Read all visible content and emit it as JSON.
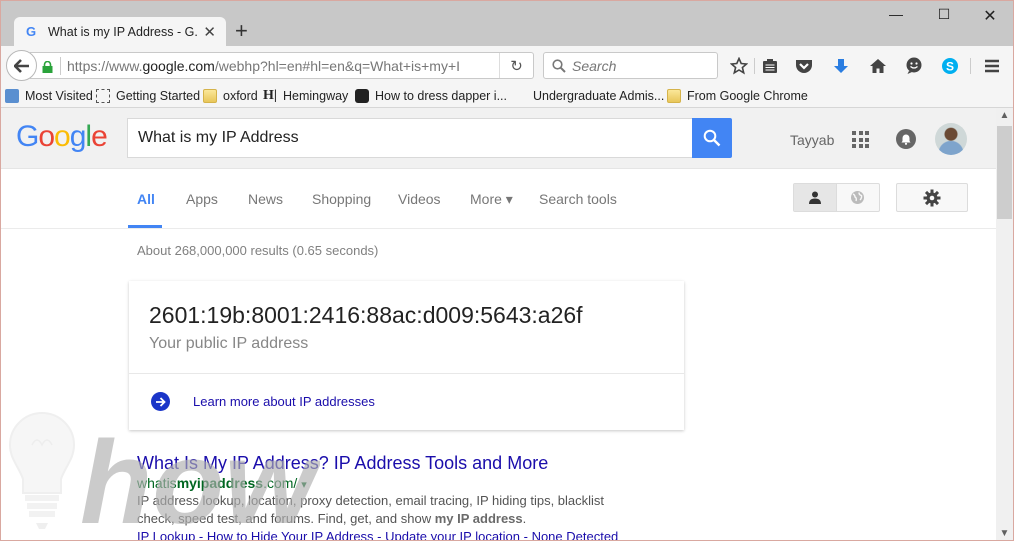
{
  "browser": {
    "tab_title": "What is my IP Address - G...",
    "new_tab_icon": "plus-icon",
    "window_controls": [
      "minimize",
      "maximize",
      "close"
    ],
    "url_host": "https://www.google.com",
    "url_prefix": "https://www.",
    "url_domain": "google.com",
    "url_path": "/webhp?hl=en#hl=en&q=What+is+my+I",
    "search_placeholder": "Search",
    "toolbar_icons": [
      "bookmark-star-icon",
      "reading-list-icon",
      "pocket-icon",
      "download-icon",
      "home-icon",
      "chat-icon",
      "skype-icon",
      "menu-icon"
    ],
    "download_color": "#2a7de1",
    "skype_color": "#00aff0"
  },
  "bookmarks": [
    {
      "label": "Most Visited",
      "icon": "most-visited-icon"
    },
    {
      "label": "Getting Started",
      "icon": "getting-started-icon"
    },
    {
      "label": "oxford",
      "icon": "folder-icon"
    },
    {
      "label": "Hemingway",
      "icon": "hemingway-icon"
    },
    {
      "label": "How to dress dapper i...",
      "icon": "site-icon"
    },
    {
      "label": "Undergraduate Admis...",
      "icon": ""
    },
    {
      "label": "From Google Chrome",
      "icon": "folder-icon"
    }
  ],
  "google": {
    "logo_letters": [
      "G",
      "o",
      "o",
      "g",
      "l",
      "e"
    ],
    "logo_colors": [
      "#4285f4",
      "#ea4335",
      "#fbbc05",
      "#4285f4",
      "#34a853",
      "#ea4335"
    ],
    "query": "What is my IP Address",
    "user_name": "Tayyab",
    "accent": "#4285f4"
  },
  "tabs": [
    {
      "label": "All",
      "active": true
    },
    {
      "label": "Apps",
      "active": false
    },
    {
      "label": "News",
      "active": false
    },
    {
      "label": "Shopping",
      "active": false
    },
    {
      "label": "Videos",
      "active": false
    },
    {
      "label": "More ▾",
      "active": false
    },
    {
      "label": "Search tools",
      "active": false
    }
  ],
  "result_stats": "About 268,000,000 results (0.65 seconds)",
  "ip_card": {
    "ip": "2601:19b:8001:2416:88ac:d009:5643:a26f",
    "subtitle": "Your public IP address",
    "learn_more": "Learn more about IP addresses"
  },
  "result": {
    "title": "What Is My IP Address? IP Address Tools and More",
    "url_pre": "whatis",
    "url_bold": "myipaddress",
    "url_post": ".com/",
    "url_caret": "▾",
    "snippet_1": "IP address lookup, location, proxy detection, email tracing, IP hiding tips, blacklist check, speed test, and forums. Find, get, and show ",
    "snippet_bold": "my IP address",
    "snippet_end": ".",
    "sitelinks": "IP Lookup - How to Hide Your IP Address - Update your IP location - None Detected"
  },
  "watermark": "how"
}
